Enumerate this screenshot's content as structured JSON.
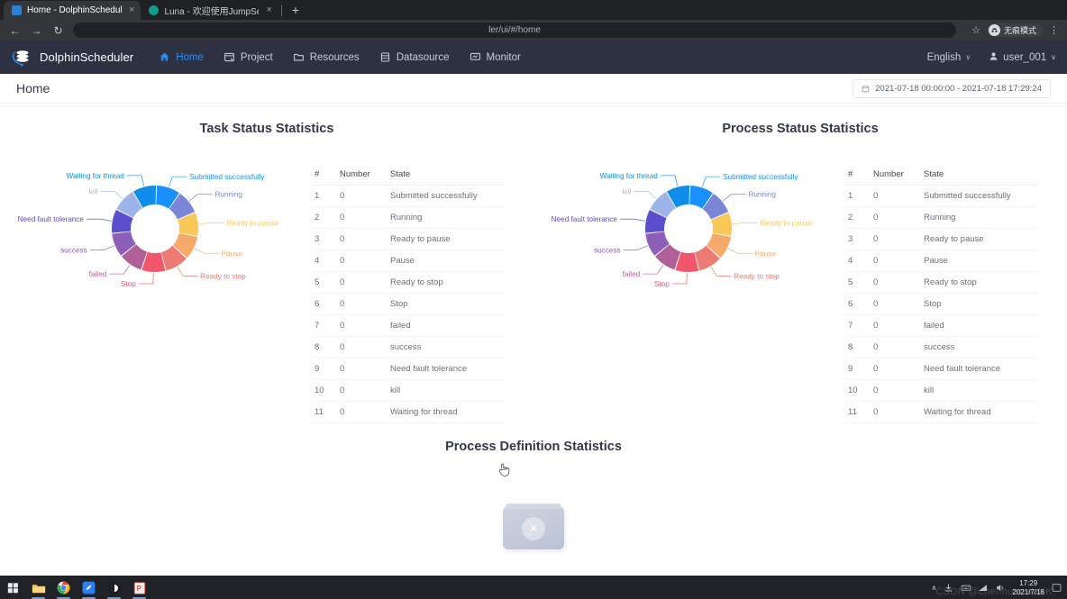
{
  "browser": {
    "tabs": [
      {
        "title": "Home - DolphinScheduler - D",
        "favicon": "dolphinscheduler-favicon",
        "close": "×",
        "active": true
      },
      {
        "title": "Luna - 欢迎使用JumpServer开",
        "favicon": "luna-favicon",
        "close": "×",
        "active": false
      }
    ],
    "new_tab_label": "+",
    "back_label": "←",
    "forward_label": "→",
    "reload_label": "↻",
    "url": "ler/ui/#/home",
    "star_label": "☆",
    "incognito_label": "无痕模式",
    "menu_label": "⋮"
  },
  "app": {
    "brand": "DolphinScheduler",
    "nav": [
      {
        "label": "Home",
        "icon": "home-icon",
        "active": true
      },
      {
        "label": "Project",
        "icon": "project-icon",
        "active": false
      },
      {
        "label": "Resources",
        "icon": "folder-icon",
        "active": false
      },
      {
        "label": "Datasource",
        "icon": "database-icon",
        "active": false
      },
      {
        "label": "Monitor",
        "icon": "monitor-icon",
        "active": false
      }
    ],
    "language": "English",
    "user": "user_001",
    "caret": "∨"
  },
  "page": {
    "title": "Home",
    "date_range": "2021-07-18 00:00:00 - 2021-07-18 17:29:24",
    "calendar_icon": "calendar-icon"
  },
  "table_headers": {
    "index": "#",
    "number": "Number",
    "state": "State"
  },
  "process_definition": {
    "title": "Process Definition Statistics",
    "empty_icon": "broken-image-icon",
    "empty_mark": "×"
  },
  "taskbar": {
    "apps": [
      {
        "name": "start-button",
        "label": "⊞"
      },
      {
        "name": "file-explorer",
        "label": ""
      },
      {
        "name": "chrome",
        "label": ""
      },
      {
        "name": "editor-app",
        "label": ""
      },
      {
        "name": "browser-app",
        "label": ""
      },
      {
        "name": "powerpoint",
        "label": "P"
      }
    ],
    "tray_expand": "∧",
    "time": "17:29",
    "date": "2021/7/18",
    "watermark": "CSDN @chenhuanwuKK"
  },
  "chart_data": [
    {
      "type": "pie",
      "title": "Task Status Statistics",
      "subtype": "donut",
      "legend_position": "labels-outside",
      "categories": [
        "Submitted successfully",
        "Running",
        "Ready to pause",
        "Pause",
        "Ready to stop",
        "Stop",
        "failed",
        "success",
        "Need fault tolerance",
        "kill",
        "Waiting for thread"
      ],
      "values": [
        0,
        0,
        0,
        0,
        0,
        0,
        0,
        0,
        0,
        0,
        0
      ],
      "display_values": [
        "0",
        "0",
        "0",
        "0",
        "0",
        "0",
        "0",
        "0",
        "0",
        "0",
        "0"
      ],
      "colors": [
        "#1890ff",
        "#7b87d6",
        "#fac858",
        "#f5a96a",
        "#ee7b73",
        "#f2566a",
        "#b06099",
        "#8c5fb8",
        "#5a4fcf",
        "#9eb4e8",
        "#0f8ee9"
      ],
      "table": {
        "columns": [
          "#",
          "Number",
          "State"
        ],
        "rows": [
          [
            "1",
            "0",
            "Submitted successfully"
          ],
          [
            "2",
            "0",
            "Running"
          ],
          [
            "3",
            "0",
            "Ready to pause"
          ],
          [
            "4",
            "0",
            "Pause"
          ],
          [
            "5",
            "0",
            "Ready to stop"
          ],
          [
            "6",
            "0",
            "Stop"
          ],
          [
            "7",
            "0",
            "failed"
          ],
          [
            "8",
            "0",
            "success"
          ],
          [
            "9",
            "0",
            "Need fault tolerance"
          ],
          [
            "10",
            "0",
            "kill"
          ],
          [
            "11",
            "0",
            "Waiting for thread"
          ]
        ]
      }
    },
    {
      "type": "pie",
      "title": "Process Status Statistics",
      "subtype": "donut",
      "legend_position": "labels-outside",
      "categories": [
        "Submitted successfully",
        "Running",
        "Ready to pause",
        "Pause",
        "Ready to stop",
        "Stop",
        "failed",
        "success",
        "Need fault tolerance",
        "kill",
        "Waiting for thread"
      ],
      "values": [
        0,
        0,
        0,
        0,
        0,
        0,
        0,
        0,
        0,
        0,
        0
      ],
      "display_values": [
        "0",
        "0",
        "0",
        "0",
        "0",
        "0",
        "0",
        "0",
        "0",
        "0",
        "0"
      ],
      "colors": [
        "#1890ff",
        "#7b87d6",
        "#fac858",
        "#f5a96a",
        "#ee7b73",
        "#f2566a",
        "#b06099",
        "#8c5fb8",
        "#5a4fcf",
        "#9eb4e8",
        "#0f8ee9"
      ],
      "table": {
        "columns": [
          "#",
          "Number",
          "State"
        ],
        "rows": [
          [
            "1",
            "0",
            "Submitted successfully"
          ],
          [
            "2",
            "0",
            "Running"
          ],
          [
            "3",
            "0",
            "Ready to pause"
          ],
          [
            "4",
            "0",
            "Pause"
          ],
          [
            "5",
            "0",
            "Ready to stop"
          ],
          [
            "6",
            "0",
            "Stop"
          ],
          [
            "7",
            "0",
            "failed"
          ],
          [
            "8",
            "0",
            "success"
          ],
          [
            "9",
            "0",
            "Need fault tolerance"
          ],
          [
            "10",
            "0",
            "kill"
          ],
          [
            "11",
            "0",
            "Waiting for thread"
          ]
        ]
      }
    }
  ]
}
